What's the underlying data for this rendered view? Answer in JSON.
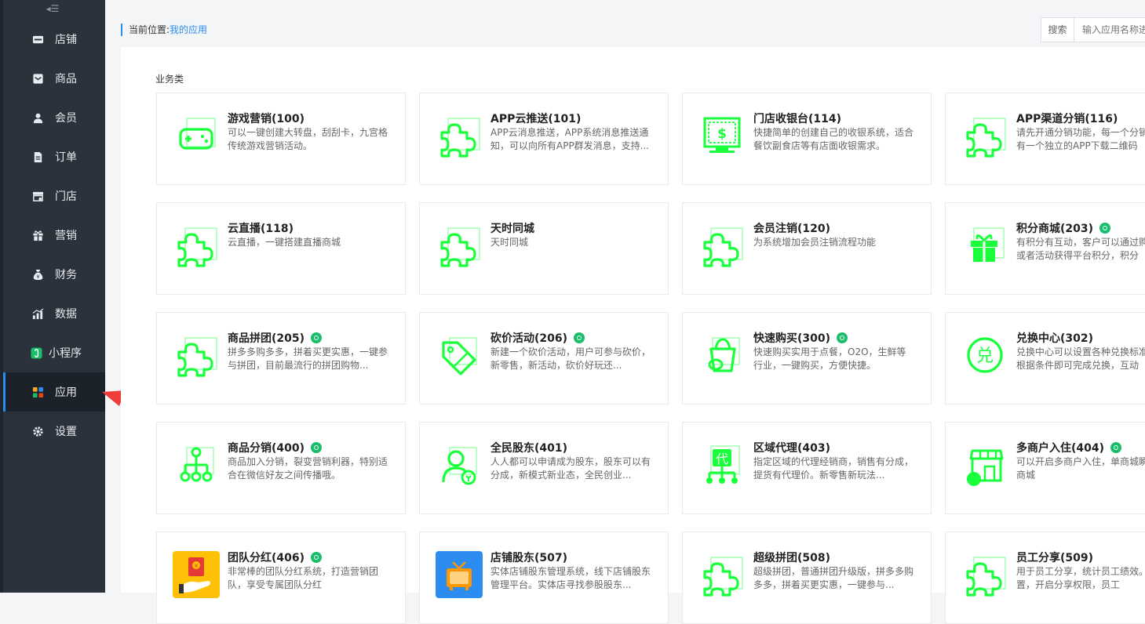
{
  "sidebar": {
    "collapse_glyph": "◂☰",
    "items": [
      {
        "label": "店铺",
        "icon": "store-icon"
      },
      {
        "label": "商品",
        "icon": "goods-icon"
      },
      {
        "label": "会员",
        "icon": "member-icon"
      },
      {
        "label": "订单",
        "icon": "order-icon"
      },
      {
        "label": "门店",
        "icon": "shop-icon"
      },
      {
        "label": "营销",
        "icon": "gift-icon"
      },
      {
        "label": "财务",
        "icon": "money-bag-icon"
      },
      {
        "label": "数据",
        "icon": "bar-chart-icon"
      },
      {
        "label": "小程序",
        "icon": "mini-program-icon"
      },
      {
        "label": "应用",
        "icon": "apps-grid-icon",
        "active": true
      },
      {
        "label": "设置",
        "icon": "gear-icon"
      }
    ]
  },
  "breadcrumb": {
    "prefix": "当前位置:",
    "current": "我的应用"
  },
  "search": {
    "button_label": "搜索",
    "placeholder": "输入应用名称进行搜索"
  },
  "section_title": "业务类",
  "accent_color": "#2d8cf0",
  "icon_color": "#1aff3c",
  "cards": [
    {
      "title": "游戏营销(100)",
      "desc": "可以一键创建大转盘，刮刮卡，九宫格传统游戏营销活动。",
      "icon": "gamepad-icon",
      "badge": false
    },
    {
      "title": "APP云推送(101)",
      "desc": "APP云消息推送，APP系统消息推送通知，可以向所有APP群发消息，支持...",
      "icon": "puzzle-icon",
      "badge": false
    },
    {
      "title": "门店收银台(114)",
      "desc": "快捷简单的创建自己的收银系统，适合餐饮副食店等有店面收银需求。",
      "icon": "cashier-icon",
      "badge": false
    },
    {
      "title": "APP渠道分销(116)",
      "desc": "请先开通分销功能，每一个分销商都会有一个独立的APP下载二维码",
      "icon": "puzzle-icon",
      "badge": false
    },
    {
      "title": "云直播(118)",
      "desc": "云直播，一键搭建直播商城",
      "icon": "puzzle-icon",
      "badge": false
    },
    {
      "title": "天时同城",
      "desc": "天时同城",
      "icon": "puzzle-icon",
      "badge": false
    },
    {
      "title": "会员注销(120)",
      "desc": "为系统增加会员注销流程功能",
      "icon": "puzzle-icon",
      "badge": false
    },
    {
      "title": "积分商城(203)",
      "desc": "有积分有互动，客户可以通过购买商品或者活动获得平台积分，积分",
      "icon": "gift-box-icon",
      "badge": true
    },
    {
      "title": "商品拼团(205)",
      "desc": "拼多多购多多，拼着买更实惠，一键参与拼团，目前最流行的拼团购物...",
      "icon": "puzzle-icon",
      "badge": true
    },
    {
      "title": "砍价活动(206)",
      "desc": "新建一个砍价活动，用户可参与砍价，新零售，新活动，砍价好玩还...",
      "icon": "price-tag-icon",
      "badge": true
    },
    {
      "title": "快速购买(300)",
      "desc": "快速购买实用于点餐，O2O，生鲜等行业，一键购买，方便快捷。",
      "icon": "fast-buy-icon",
      "badge": true
    },
    {
      "title": "兑换中心(302)",
      "desc": "兑换中心可以设置各种兑换标准，会员根据条件即可完成兑换，互动",
      "icon": "exchange-icon",
      "badge": false
    },
    {
      "title": "商品分销(400)",
      "desc": "商品加入分销，裂变营销利器，特别适合在微信好友之间传播哦。",
      "icon": "network-icon",
      "badge": true
    },
    {
      "title": "全民股东(401)",
      "desc": "人人都可以申请成为股东，股东可以有分成，新模式新业态，全民创业...",
      "icon": "shareholder-icon",
      "badge": false
    },
    {
      "title": "区域代理(403)",
      "desc": "指定区域的代理经销商，销售有分成，提货有代理价。新零售新玩法...",
      "icon": "agent-icon",
      "badge": false
    },
    {
      "title": "多商户入住(404)",
      "desc": "可以开启多商户入住，单商城瞬间变多商城",
      "icon": "multi-store-icon",
      "badge": true
    },
    {
      "title": "团队分红(406)",
      "desc": "非常棒的团队分红系统，打造营销团队，享受专属团队分红",
      "icon": "red-envelope-icon",
      "badge": true
    },
    {
      "title": "店铺股东(507)",
      "desc": "实体店铺股东管理系统，线下店铺股东管理平台。实体店寻找参股股东...",
      "icon": "tv-icon",
      "badge": false
    },
    {
      "title": "超级拼团(508)",
      "desc": "超级拼团，普通拼团升级版，拼多多购多多，拼着买更实惠，一键参与...",
      "icon": "puzzle-icon",
      "badge": false
    },
    {
      "title": "员工分享(509)",
      "desc": "用于员工分享，统计员工绩效。后台设置，开启分享权限，员工",
      "icon": "puzzle-icon",
      "badge": false
    }
  ]
}
